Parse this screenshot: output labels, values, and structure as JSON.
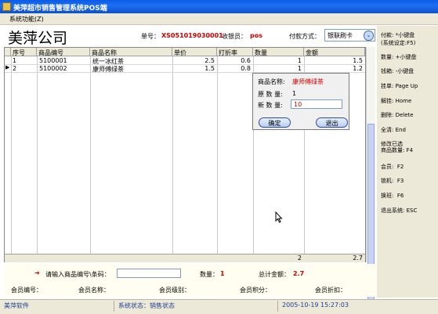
{
  "window": {
    "title": "美萍超市销售管理系统POS端"
  },
  "menu": {
    "system": "系统功能(Z)"
  },
  "header": {
    "company": "美萍公司",
    "order_label": "单号：",
    "order_no": "XS051019030001",
    "cashier_label": "收银员：",
    "cashier": "pos",
    "payment_label": "付款方式：",
    "payment_value": "银联刷卡",
    "dropdown_arrow": "⌄"
  },
  "table": {
    "columns": [
      "序号",
      "商品编号",
      "商品名称",
      "单价",
      "打折率",
      "数量",
      "金额"
    ],
    "rows": [
      {
        "seq": "1",
        "code": "5100001",
        "name": "统一冰红茶",
        "price": "2.5",
        "discount": "0.6",
        "qty": "1",
        "amount": "1.5"
      },
      {
        "seq": "2",
        "code": "5100002",
        "name": "康师傅绿茶",
        "price": "1.5",
        "discount": "0.8",
        "qty": "1",
        "amount": "1.2"
      }
    ],
    "row_indicator": "▶",
    "totals": {
      "qty": "2",
      "amount": "2.7"
    }
  },
  "popup": {
    "name_label": "商品名称:",
    "name_value": "康师傅绿茶",
    "orig_label": "原 数 量:",
    "orig_value": "1",
    "new_label": "新 数 量:",
    "new_value": "10",
    "confirm": "确定",
    "exit": "退出"
  },
  "shortcuts": [
    {
      "label": "付款:",
      "key": "*小键盘"
    },
    {
      "label": "(系统设定:F5)",
      "key": ""
    },
    {
      "label": "数量:",
      "key": "+小键盘"
    },
    {
      "label": "钱箱:",
      "key": "-小键盘"
    },
    {
      "label": "挂单:",
      "key": "Page Up"
    },
    {
      "label": "解挂:",
      "key": "Home"
    },
    {
      "label": "删除:",
      "key": "Delete"
    },
    {
      "label": "全清:",
      "key": "End"
    },
    {
      "label": "修改已选",
      "key": ""
    },
    {
      "label": "商品数量:",
      "key": "F4"
    },
    {
      "label": "会员:",
      "key": "F2"
    },
    {
      "label": "锁机:",
      "key": "F3"
    },
    {
      "label": "换班:",
      "key": "F6"
    },
    {
      "label": "退出系统:",
      "key": "ESC"
    }
  ],
  "bottom": {
    "barcode_label": "请输入商品编号\\条码：",
    "barcode_value": "",
    "qty_label": "数量：",
    "qty_value": "1",
    "total_label": "总计金额：",
    "total_value": "2.7",
    "member_no": "会员编号：",
    "member_name": "会员名称：",
    "member_level": "会员级别：",
    "member_points": "会员积分：",
    "member_discount": "会员折扣："
  },
  "status": {
    "brand": "美萍软件",
    "state": "系统状态：销售状态",
    "datetime": "2005-10-19 15:27:03"
  },
  "colors": {
    "titlebar": "#0a5be8",
    "accent_red": "#d00000",
    "status_text": "#1f3f8f"
  }
}
